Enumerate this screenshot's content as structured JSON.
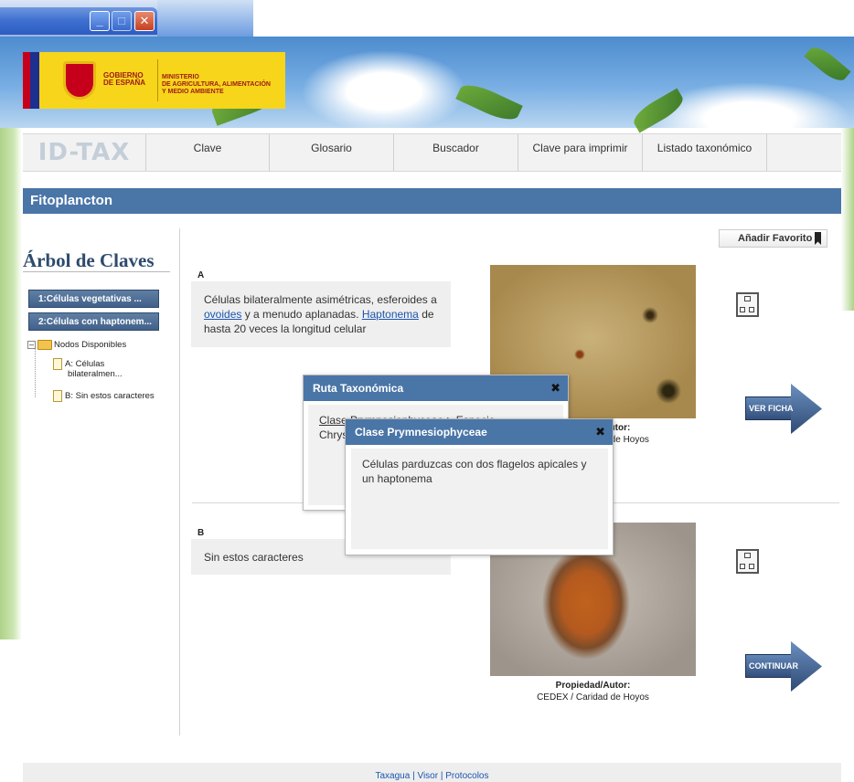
{
  "window": {
    "min_glyph": "_",
    "max_glyph": "□",
    "close_glyph": "✕"
  },
  "header": {
    "gov_line1": "GOBIERNO",
    "gov_line2": "DE ESPAÑA",
    "ministry_line1": "MINISTERIO",
    "ministry_line2": "DE AGRICULTURA, ALIMENTACIÓN",
    "ministry_line3": "Y MEDIO AMBIENTE"
  },
  "nav": {
    "brand": "ID-TAX",
    "items": [
      "Clave",
      "Glosario",
      "Buscador",
      "Clave para imprimir",
      "Listado taxonómico"
    ]
  },
  "section": {
    "title": "Fitoplancton"
  },
  "sidebar": {
    "title": "Árbol de Claves",
    "buttons": [
      "1:Células vegetativas ...",
      "2:Células con haptonem..."
    ],
    "tree_root": "Nodos Disponibles",
    "tree_items": [
      "A: Células",
      "bilateralmen...",
      "B: Sin estos caracteres"
    ]
  },
  "favorite": {
    "label": "Añadir Favorito"
  },
  "items": [
    {
      "letter": "A",
      "desc_pre": "Células bilateralmente asimétricas, esferoides a ",
      "link1": "ovoides",
      "desc_mid": " y a menudo aplanadas. ",
      "link2": "Haptonema",
      "desc_post": " de hasta 20 veces la longitud celular",
      "credit_label": "Propiedad/Autor:",
      "credit_value": "CEDEX / Caridad de Hoyos",
      "action": "VER FICHA"
    },
    {
      "letter": "B",
      "desc": "Sin estos caracteres",
      "credit_label": "Propiedad/Autor:",
      "credit_value": "CEDEX / Caridad de Hoyos",
      "action": "CONTINUAR"
    }
  ],
  "popup_route": {
    "title": "Ruta Taxonómica",
    "line1": "Clase Prymnesiophyceae > Especie",
    "line2": "Chrys"
  },
  "popup_class": {
    "title": "Clase Prymnesiophyceae",
    "body": "Células parduzcas con dos flagelos apicales y un haptonema"
  },
  "footer": {
    "links": [
      "Taxagua",
      "Visor",
      "Protocolos"
    ],
    "sep": " | "
  },
  "icons": [
    "minimize-icon",
    "maximize-icon",
    "close-icon",
    "bookmark-icon",
    "taxonomy-tree-icon",
    "folder-icon",
    "document-icon",
    "arrow-icon"
  ]
}
